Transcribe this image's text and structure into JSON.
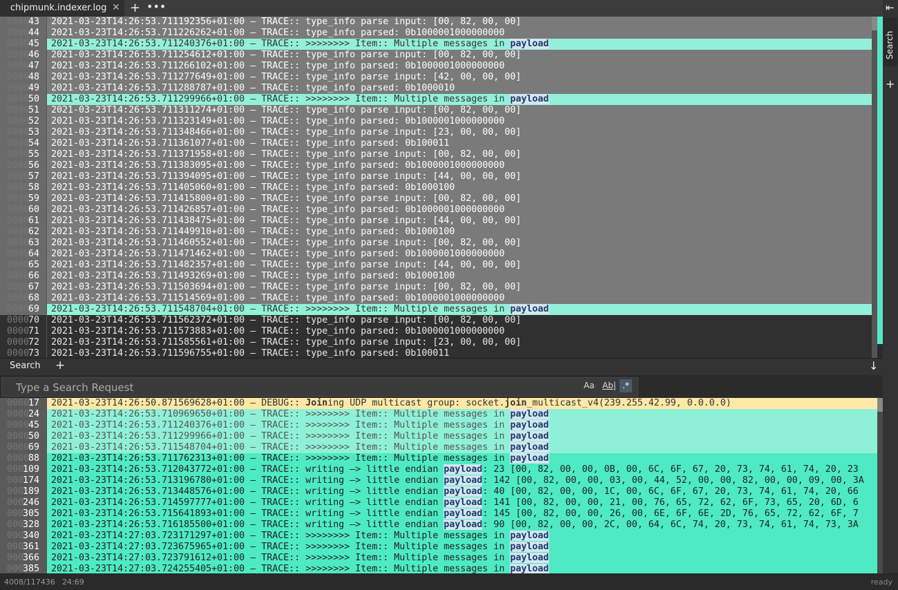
{
  "tab": {
    "title": "chipmunk.indexer.log",
    "close": "✕",
    "add": "+",
    "more": "•••"
  },
  "sidebar": {
    "arrow": "⇤",
    "search_label": "Search",
    "add": "+"
  },
  "main_rows": [
    {
      "z": "0000",
      "n": "43",
      "t": "2021-03-23T14:26:53.711192356+01:00 — TRACE:: type_info parse input: [00, 82, 00, 00]",
      "k": "sel"
    },
    {
      "z": "0000",
      "n": "44",
      "t": "2021-03-23T14:26:53.711226262+01:00 — TRACE:: type_info parsed: 0b1000001000000000",
      "k": "sel"
    },
    {
      "z": "0000",
      "n": "45",
      "t": "2021-03-23T14:26:53.711240376+01:00 — TRACE:: >>>>>>>> Item:: Multiple messages in ",
      "p": "payload",
      "k": "hl"
    },
    {
      "z": "0000",
      "n": "46",
      "t": "2021-03-23T14:26:53.711254612+01:00 — TRACE:: type_info parse input: [00, 82, 00, 00]",
      "k": "sel"
    },
    {
      "z": "0000",
      "n": "47",
      "t": "2021-03-23T14:26:53.711266102+01:00 — TRACE:: type_info parsed: 0b1000001000000000",
      "k": "sel"
    },
    {
      "z": "0000",
      "n": "48",
      "t": "2021-03-23T14:26:53.711277649+01:00 — TRACE:: type_info parse input: [42, 00, 00, 00]",
      "k": "sel"
    },
    {
      "z": "0000",
      "n": "49",
      "t": "2021-03-23T14:26:53.711288787+01:00 — TRACE:: type_info parsed: 0b1000010",
      "k": "sel"
    },
    {
      "z": "0000",
      "n": "50",
      "t": "2021-03-23T14:26:53.711299966+01:00 — TRACE:: >>>>>>>> Item:: Multiple messages in ",
      "p": "payload",
      "k": "hl"
    },
    {
      "z": "0000",
      "n": "51",
      "t": "2021-03-23T14:26:53.711311274+01:00 — TRACE:: type_info parse input: [00, 82, 00, 00]",
      "k": "sel"
    },
    {
      "z": "0000",
      "n": "52",
      "t": "2021-03-23T14:26:53.711323149+01:00 — TRACE:: type_info parsed: 0b1000001000000000",
      "k": "sel"
    },
    {
      "z": "0000",
      "n": "53",
      "t": "2021-03-23T14:26:53.711348466+01:00 — TRACE:: type_info parse input: [23, 00, 00, 00]",
      "k": "sel"
    },
    {
      "z": "0000",
      "n": "54",
      "t": "2021-03-23T14:26:53.711361077+01:00 — TRACE:: type_info parsed: 0b100011",
      "k": "sel"
    },
    {
      "z": "0000",
      "n": "55",
      "t": "2021-03-23T14:26:53.711371958+01:00 — TRACE:: type_info parse input: [00, 82, 00, 00]",
      "k": "sel"
    },
    {
      "z": "0000",
      "n": "56",
      "t": "2021-03-23T14:26:53.711383095+01:00 — TRACE:: type_info parsed: 0b1000001000000000",
      "k": "sel"
    },
    {
      "z": "0000",
      "n": "57",
      "t": "2021-03-23T14:26:53.711394095+01:00 — TRACE:: type_info parse input: [44, 00, 00, 00]",
      "k": "sel"
    },
    {
      "z": "0000",
      "n": "58",
      "t": "2021-03-23T14:26:53.711405060+01:00 — TRACE:: type_info parsed: 0b1000100",
      "k": "sel"
    },
    {
      "z": "0000",
      "n": "59",
      "t": "2021-03-23T14:26:53.711415800+01:00 — TRACE:: type_info parse input: [00, 82, 00, 00]",
      "k": "sel"
    },
    {
      "z": "0000",
      "n": "60",
      "t": "2021-03-23T14:26:53.711426857+01:00 — TRACE:: type_info parsed: 0b1000001000000000",
      "k": "sel"
    },
    {
      "z": "0000",
      "n": "61",
      "t": "2021-03-23T14:26:53.711438475+01:00 — TRACE:: type_info parse input: [44, 00, 00, 00]",
      "k": "sel"
    },
    {
      "z": "0000",
      "n": "62",
      "t": "2021-03-23T14:26:53.711449910+01:00 — TRACE:: type_info parsed: 0b1000100",
      "k": "sel"
    },
    {
      "z": "0000",
      "n": "63",
      "t": "2021-03-23T14:26:53.711460552+01:00 — TRACE:: type_info parse input: [00, 82, 00, 00]",
      "k": "sel"
    },
    {
      "z": "0000",
      "n": "64",
      "t": "2021-03-23T14:26:53.711471462+01:00 — TRACE:: type_info parsed: 0b1000001000000000",
      "k": "sel"
    },
    {
      "z": "0000",
      "n": "65",
      "t": "2021-03-23T14:26:53.711482357+01:00 — TRACE:: type_info parse input: [44, 00, 00, 00]",
      "k": "sel"
    },
    {
      "z": "0000",
      "n": "66",
      "t": "2021-03-23T14:26:53.711493269+01:00 — TRACE:: type_info parsed: 0b1000100",
      "k": "sel"
    },
    {
      "z": "0000",
      "n": "67",
      "t": "2021-03-23T14:26:53.711503694+01:00 — TRACE:: type_info parse input: [00, 82, 00, 00]",
      "k": "sel"
    },
    {
      "z": "0000",
      "n": "68",
      "t": "2021-03-23T14:26:53.711514569+01:00 — TRACE:: type_info parsed: 0b1000001000000000",
      "k": "sel"
    },
    {
      "z": "0000",
      "n": "69",
      "t": "2021-03-23T14:26:53.711548704+01:00 — TRACE:: >>>>>>>> Item:: Multiple messages in ",
      "p": "payload",
      "k": "hl"
    },
    {
      "z": "0000",
      "n": "70",
      "t": "2021-03-23T14:26:53.711562372+01:00 — TRACE:: type_info parse input: [00, 82, 00, 00]",
      "k": "norm"
    },
    {
      "z": "0000",
      "n": "71",
      "t": "2021-03-23T14:26:53.711573883+01:00 — TRACE:: type_info parsed: 0b1000001000000000",
      "k": "norm"
    },
    {
      "z": "0000",
      "n": "72",
      "t": "2021-03-23T14:26:53.711585561+01:00 — TRACE:: type_info parse input: [23, 00, 00, 00]",
      "k": "norm"
    },
    {
      "z": "0000",
      "n": "73",
      "t": "2021-03-23T14:26:53.711596755+01:00 — TRACE:: type_info parsed: 0b100011",
      "k": "norm"
    }
  ],
  "search_header": {
    "label": "Search",
    "add": "+",
    "down": "↓"
  },
  "search_input": {
    "placeholder": "Type a Search Request",
    "case": "Aa",
    "word": "Ab|",
    "regex": ".*"
  },
  "results": [
    {
      "z": "0000",
      "n": "17",
      "pre": "2021-03-23T14:26:50.871569628+01:00 — DEBUG:: ",
      "kw1": "Join",
      "mid": "ing UDP multicast group: socket.",
      "kw2": "join",
      "post": "_multicast_v4(239.255.42.99, 0.0.0.0)",
      "k": "warn"
    },
    {
      "z": "0000",
      "n": "24",
      "pre": "2021-03-23T14:26:53.710969650+01:00 — TRACE:: >>>>>>>> Item:: Multiple messages in ",
      "p": "payload",
      "k": "light"
    },
    {
      "z": "0000",
      "n": "45",
      "pre": "2021-03-23T14:26:53.711240376+01:00 — TRACE:: >>>>>>>> Item:: Multiple messages in ",
      "p": "payload",
      "k": "light"
    },
    {
      "z": "0000",
      "n": "50",
      "pre": "2021-03-23T14:26:53.711299966+01:00 — TRACE:: >>>>>>>> Item:: Multiple messages in ",
      "p": "payload",
      "k": "light"
    },
    {
      "z": "0000",
      "n": "69",
      "pre": "2021-03-23T14:26:53.711548704+01:00 — TRACE:: >>>>>>>> Item:: Multiple messages in ",
      "p": "payload",
      "k": "light"
    },
    {
      "z": "0000",
      "n": "88",
      "pre": "2021-03-23T14:26:53.711762313+01:00 — TRACE:: >>>>>>>> Item:: Multiple messages in ",
      "p": "payload",
      "k": "strong"
    },
    {
      "z": "000",
      "n": "109",
      "pre": "2021-03-23T14:26:53.712043772+01:00 — TRACE:: writing —> little endian ",
      "p": "payload",
      "post": ": 23 [00, 82, 00, 00, 0B, 00, 6C, 6F, 67, 20, 73, 74, 61, 74, 20, 23",
      "k": "strong"
    },
    {
      "z": "000",
      "n": "174",
      "pre": "2021-03-23T14:26:53.713196780+01:00 — TRACE:: writing —> little endian ",
      "p": "payload",
      "post": ": 142 [00, 82, 00, 00, 03, 00, 44, 52, 00, 00, 82, 00, 00, 09, 00, 3A",
      "k": "strong"
    },
    {
      "z": "000",
      "n": "189",
      "pre": "2021-03-23T14:26:53.713448576+01:00 — TRACE:: writing —> little endian ",
      "p": "payload",
      "post": ": 40 [00, 82, 00, 00, 1C, 00, 6C, 6F, 67, 20, 73, 74, 61, 74, 20, 66",
      "k": "strong"
    },
    {
      "z": "000",
      "n": "246",
      "pre": "2021-03-23T14:26:53.714597777+01:00 — TRACE:: writing —> little endian ",
      "p": "payload",
      "post": ": 141 [00, 82, 00, 00, 21, 00, 76, 65, 72, 62, 6F, 73, 65, 20, 6D, 6",
      "k": "strong"
    },
    {
      "z": "000",
      "n": "305",
      "pre": "2021-03-23T14:26:53.715641893+01:00 — TRACE:: writing —> little endian ",
      "p": "payload",
      "post": ": 145 [00, 82, 00, 00, 26, 00, 6E, 6F, 6E, 2D, 76, 65, 72, 62, 6F, 7",
      "k": "strong"
    },
    {
      "z": "000",
      "n": "328",
      "pre": "2021-03-23T14:26:53.716185500+01:00 — TRACE:: writing —> little endian ",
      "p": "payload",
      "post": ": 90 [00, 82, 00, 00, 2C, 00, 64, 6C, 74, 20, 73, 74, 61, 74, 73, 3A",
      "k": "strong"
    },
    {
      "z": "000",
      "n": "340",
      "pre": "2021-03-23T14:27:03.723171297+01:00 — TRACE:: >>>>>>>> Item:: Multiple messages in ",
      "p": "payload",
      "k": "strong"
    },
    {
      "z": "000",
      "n": "361",
      "pre": "2021-03-23T14:27:03.723675965+01:00 — TRACE:: >>>>>>>> Item:: Multiple messages in ",
      "p": "payload",
      "k": "strong"
    },
    {
      "z": "000",
      "n": "366",
      "pre": "2021-03-23T14:27:03.723791612+01:00 — TRACE:: >>>>>>>> Item:: Multiple messages in ",
      "p": "payload",
      "k": "strong"
    },
    {
      "z": "000",
      "n": "385",
      "pre": "2021-03-23T14:27:03.724255405+01:00 — TRACE:: >>>>>>>> Item:: Multiple messages in ",
      "p": "payload",
      "k": "strong"
    }
  ],
  "status": {
    "count": "4008/117436",
    "position": "24:69",
    "state": "ready"
  },
  "colors": {
    "highlight": "#92f0d8",
    "match": "#4eeac3",
    "warn": "#ffe8a6",
    "selection": "#7a7a7a"
  }
}
